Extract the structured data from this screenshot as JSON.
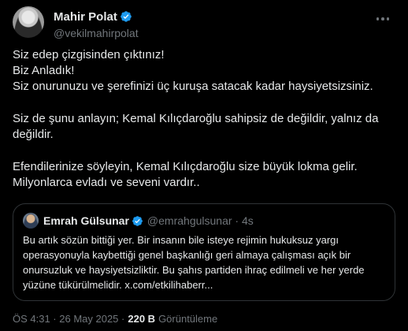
{
  "author": {
    "name": "Mahir Polat",
    "handle": "@vekilmahirpolat"
  },
  "tweet": {
    "lines_1": [
      "Siz edep çizgisinden çıktınız!",
      "Biz Anladık!",
      "Siz onurunuzu ve şerefinizi üç kuruşa satacak kadar haysiyetsizsiniz."
    ],
    "lines_2": [
      "Siz de şunu anlayın; Kemal Kılıçdaroğlu sahipsiz de değildir, yalnız da",
      "değildir."
    ],
    "lines_3": [
      "Efendilerinize söyleyin, Kemal Kılıçdaroğlu size büyük lokma gelir.",
      "Milyonlarca evladı ve seveni vardır.."
    ]
  },
  "quote": {
    "name": "Emrah Gülsunar",
    "handle": "@emrahgulsunar · 4s",
    "lines": [
      "Bu artık sözün bittiği yer. Bir insanın bile isteye rejimin hukuksuz yargı",
      "operasyonuyla kaybettiği genel başkanlığı geri almaya çalışması açık bir",
      "onursuzluk ve haysiyetsizliktir. Bu şahıs partiden ihraç edilmeli ve her yerde",
      "yüzüne tükürülmelidir. x.com/etkilihaberr..."
    ]
  },
  "meta": {
    "timestamp": "ÖS 4:31 · 26 May 2025 ·",
    "views_count": "220 B",
    "views_label": "Görüntüleme"
  },
  "colors": {
    "background": "#000000",
    "text": "#e7e9ea",
    "secondary": "#71767b",
    "verified_blue": "#1d9bf0",
    "border": "#2f3336"
  }
}
